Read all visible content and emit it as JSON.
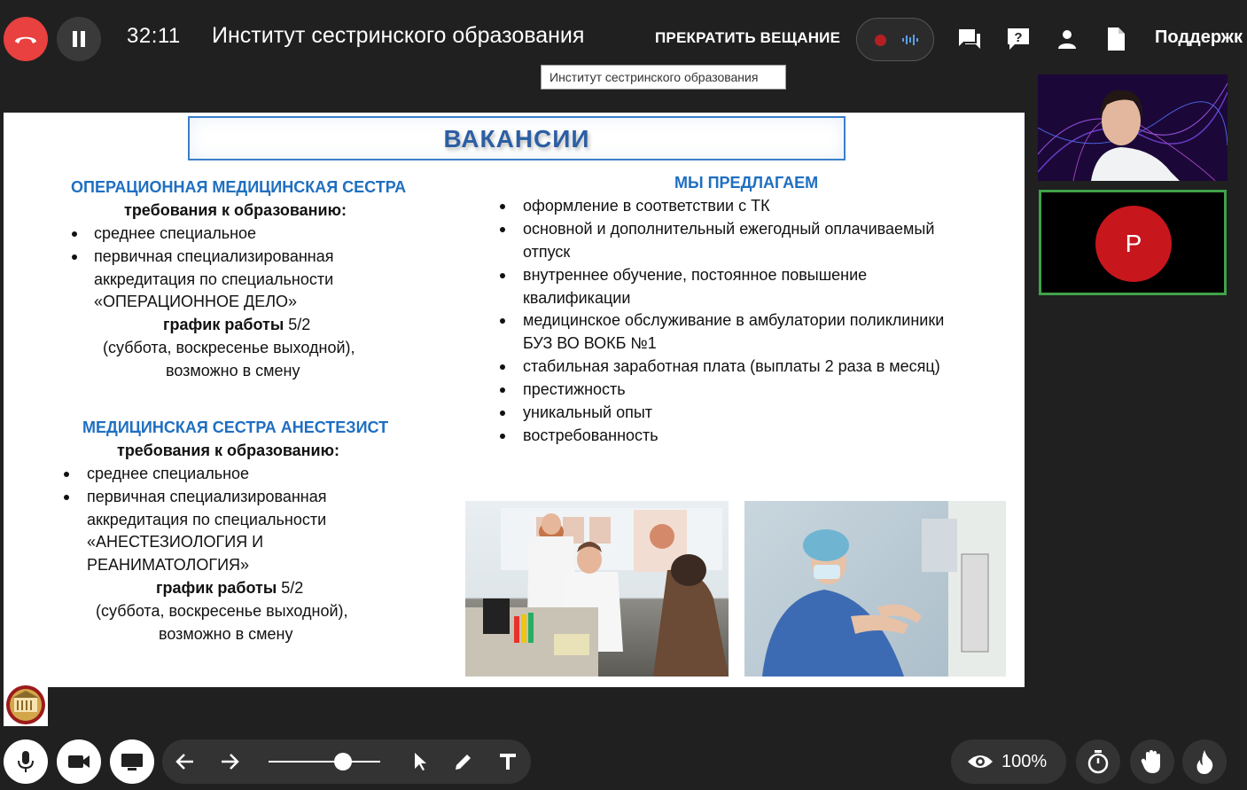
{
  "header": {
    "timer": "32:11",
    "room_title": "Институт сестринского образования",
    "stop_stream_label": "ПРЕКРАТИТЬ ВЕЩАНИЕ",
    "support_label": "Поддержк",
    "tooltip": "Институт сестринского образования",
    "icons": [
      "end-call-icon",
      "pause-icon",
      "record-icon",
      "audio-levels-icon",
      "chat-icon",
      "help-icon",
      "participants-icon",
      "document-icon"
    ]
  },
  "slide": {
    "title": "ВАКАНСИИ",
    "left_col": {
      "job1": {
        "heading": "ОПЕРАЦИОННАЯ МЕДИЦИНСКАЯ СЕСТРА",
        "requirements_label": "требования к образованию:",
        "bullets": [
          [
            "среднее специальное"
          ],
          [
            "первичная специализированная",
            "аккредитация по специальности",
            "«ОПЕРАЦИОННОЕ ДЕЛО»"
          ]
        ],
        "schedule_label": "график работы",
        "schedule_value": "5/2",
        "schedule_note": "(суббота, воскресенье выходной),",
        "shift_note": "возможно в смену"
      },
      "job2": {
        "heading": "МЕДИЦИНСКАЯ СЕСТРА АНЕСТЕЗИСТ",
        "requirements_label": "требования к образованию:",
        "bullets": [
          [
            "среднее специальное"
          ],
          [
            "первичная специализированная",
            "аккредитация по специальности",
            "«АНЕСТЕЗИОЛОГИЯ И",
            "РЕАНИМАТОЛОГИЯ»"
          ]
        ],
        "schedule_label": "график работы",
        "schedule_value": "5/2",
        "schedule_note": "(суббота, воскресенье выходной),",
        "shift_note": "возможно в смену"
      }
    },
    "right_col": {
      "heading": "МЫ ПРЕДЛАГАЕМ",
      "bullets": [
        [
          "оформление в соответствии с ТК"
        ],
        [
          "основной и дополнительный ежегодный оплачиваемый",
          "отпуск"
        ],
        [
          "внутреннее обучение, постоянное повышение",
          "квалификации"
        ],
        [
          "медицинское обслуживание в амбулатории поликлиники",
          "БУЗ ВО ВОКБ №1"
        ],
        [
          "стабильная заработная плата (выплаты 2 раза в месяц)"
        ],
        [
          "престижность"
        ],
        [
          "уникальный опыт"
        ],
        [
          "востребованность"
        ]
      ]
    }
  },
  "participants": {
    "avatar_letter": "Р",
    "accent_border": "#3fa24a",
    "avatar_color": "#c8161d"
  },
  "toolbar": {
    "zoom_label": "100%",
    "icons": [
      "microphone-icon",
      "camera-icon",
      "screen-share-icon",
      "undo-arrow-icon",
      "redo-arrow-icon",
      "pointer-icon",
      "pen-icon",
      "text-tool-icon",
      "eye-icon",
      "timer-icon",
      "raise-hand-icon",
      "fire-icon"
    ],
    "slider_level": 0.65
  },
  "colors": {
    "end_call": "#e8413f",
    "slide_heading": "#1f6fc1",
    "background": "#202020"
  }
}
